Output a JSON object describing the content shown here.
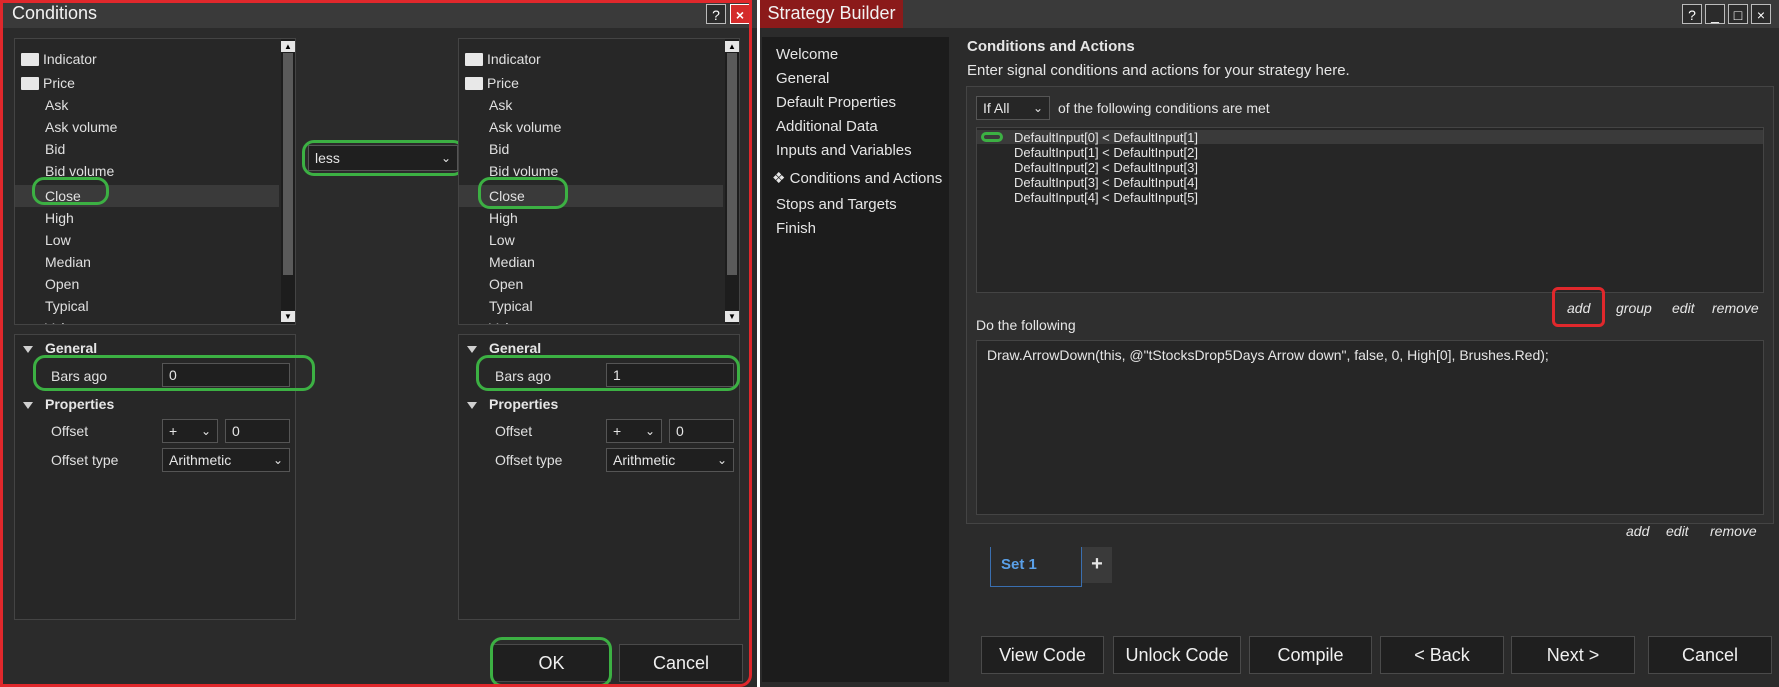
{
  "conditions": {
    "title": "Conditions",
    "help_btn": "?",
    "close_btn": "×",
    "left": {
      "tree_root": [
        "Indicator",
        "Price"
      ],
      "items": [
        "Ask",
        "Ask volume",
        "Bid",
        "Bid volume",
        "Close",
        "High",
        "Low",
        "Median",
        "Open",
        "Typical",
        "Volume"
      ],
      "selected": "Close",
      "general_label": "General",
      "bars_ago_label": "Bars ago",
      "bars_ago_value": "0",
      "properties_label": "Properties",
      "offset_label": "Offset",
      "offset_sign": "+",
      "offset_value": "0",
      "offset_type_label": "Offset type",
      "offset_type_value": "Arithmetic"
    },
    "operator": "less",
    "right": {
      "tree_root": [
        "Indicator",
        "Price"
      ],
      "items": [
        "Ask",
        "Ask volume",
        "Bid",
        "Bid volume",
        "Close",
        "High",
        "Low",
        "Median",
        "Open",
        "Typical",
        "Volume"
      ],
      "selected": "Close",
      "general_label": "General",
      "bars_ago_label": "Bars ago",
      "bars_ago_value": "1",
      "properties_label": "Properties",
      "offset_label": "Offset",
      "offset_sign": "+",
      "offset_value": "0",
      "offset_type_label": "Offset type",
      "offset_type_value": "Arithmetic"
    },
    "ok": "OK",
    "cancel": "Cancel"
  },
  "strategy_builder": {
    "title": "Strategy Builder",
    "window_btns": [
      "?",
      "_",
      "□",
      "×"
    ],
    "nav": [
      "Welcome",
      "General",
      "Default Properties",
      "Additional Data",
      "Inputs and Variables",
      "❖ Conditions and Actions",
      "Stops and Targets",
      "Finish"
    ],
    "heading": "Conditions and Actions",
    "subheading": "Enter signal conditions and actions for your strategy here.",
    "if_select": "If All",
    "if_suffix": "of the following conditions are met",
    "conditions": [
      "DefaultInput[0] < DefaultInput[1]",
      "DefaultInput[1] < DefaultInput[2]",
      "DefaultInput[2] < DefaultInput[3]",
      "DefaultInput[3] < DefaultInput[4]",
      "DefaultInput[4] < DefaultInput[5]"
    ],
    "cond_links": {
      "add": "add",
      "group": "group",
      "edit": "edit",
      "remove": "remove"
    },
    "do_label": "Do the following",
    "action": "Draw.ArrowDown(this, @\"tStocksDrop5Days Arrow down\", false, 0, High[0], Brushes.Red);",
    "action_links": {
      "add": "add",
      "edit": "edit",
      "remove": "remove"
    },
    "set_tab": "Set 1",
    "add_set": "+",
    "buttons": {
      "view_code": "View Code",
      "unlock_code": "Unlock Code",
      "compile": "Compile",
      "back": "< Back",
      "next": "Next >",
      "cancel": "Cancel"
    }
  },
  "colors": {
    "highlight_green": "#3cb043",
    "highlight_red": "#e0282c",
    "title_red": "#8b1a1a"
  }
}
